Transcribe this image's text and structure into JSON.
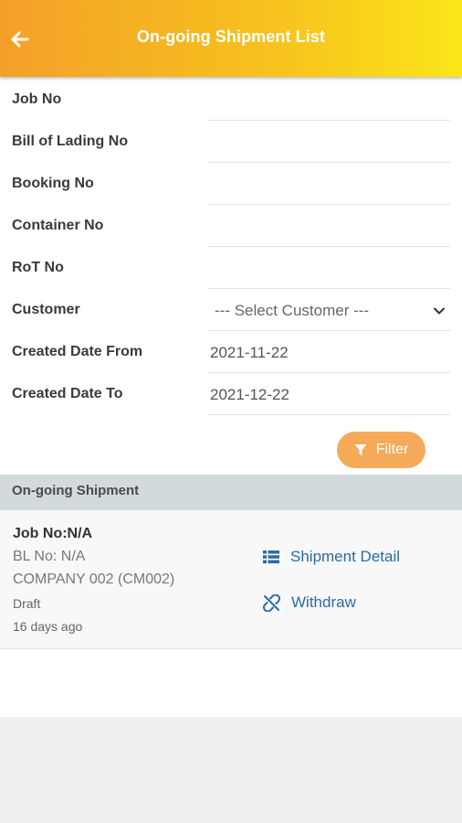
{
  "header": {
    "title": "On-going Shipment List",
    "back_icon": "arrow-left-icon"
  },
  "form": {
    "fields": [
      {
        "label": "Job No",
        "value": ""
      },
      {
        "label": "Bill of Lading No",
        "value": ""
      },
      {
        "label": "Booking No",
        "value": ""
      },
      {
        "label": "Container No",
        "value": ""
      },
      {
        "label": "RoT No",
        "value": ""
      }
    ],
    "customer": {
      "label": "Customer",
      "selected": "--- Select Customer ---"
    },
    "date_from": {
      "label": "Created Date From",
      "value": "2021-11-22"
    },
    "date_to": {
      "label": "Created Date To",
      "value": "2021-12-22"
    },
    "filter_label": "Filter"
  },
  "section": {
    "title": "On-going Shipment"
  },
  "shipments": [
    {
      "job": "Job No:N/A",
      "bl": "BL No: N/A",
      "company": "COMPANY 002 (CM002)",
      "status": "Draft",
      "age": "16 days ago",
      "detail_label": "Shipment Detail",
      "withdraw_label": "Withdraw"
    }
  ],
  "colors": {
    "header_start": "#f4a028",
    "header_end": "#fbe619",
    "filter_button": "#f5aa59",
    "link": "#2c6aa5",
    "section_bar": "#d3dade"
  }
}
